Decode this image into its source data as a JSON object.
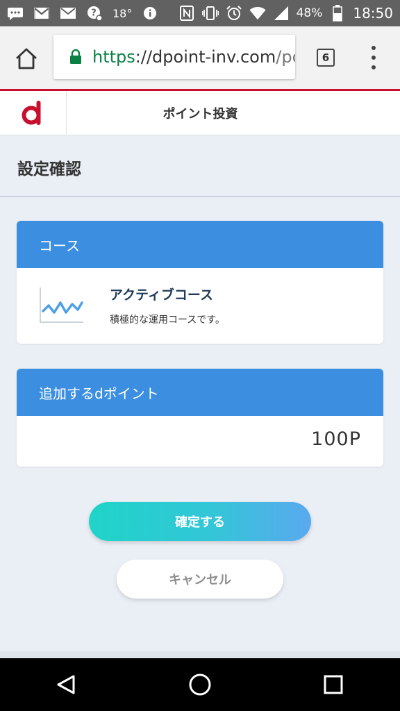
{
  "status_bar": {
    "temperature": "18°",
    "battery": "48%",
    "time": "18:50",
    "icons": [
      "message-icon",
      "gmail-icon",
      "email-icon",
      "alarm-app-icon",
      "temperature",
      "info-icon",
      "nfc-icon",
      "vibrate-icon",
      "alarm-icon",
      "wifi-icon",
      "signal-icon",
      "battery-icon"
    ]
  },
  "browser": {
    "url_scheme": "https",
    "url_host": "://dpoint-inv.com",
    "url_rest": "/pc",
    "tab_count": "6"
  },
  "app": {
    "title": "ポイント投資",
    "brand_color": "#c8102e"
  },
  "page": {
    "title": "設定確認"
  },
  "course": {
    "header": "コース",
    "name": "アクティブコース",
    "description": "積極的な運用コースです。"
  },
  "points": {
    "header": "追加するdポイント",
    "value": "100P"
  },
  "actions": {
    "confirm_label": "確定する",
    "cancel_label": "キャンセル"
  },
  "colors": {
    "card_header": "#3b8ee0",
    "confirm_gradient_start": "#1fd4c8",
    "confirm_gradient_end": "#5aa9ee"
  }
}
